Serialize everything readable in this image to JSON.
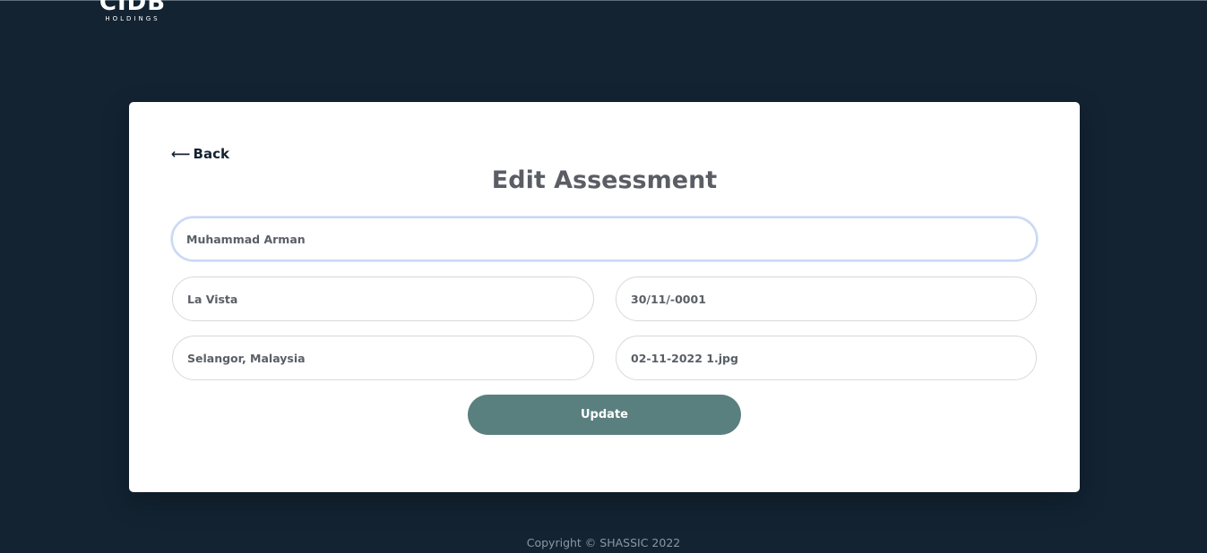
{
  "logo": {
    "main": "CIDB",
    "sub": "HOLDINGS"
  },
  "back_link": {
    "arrow": "⟵",
    "label": "Back"
  },
  "form": {
    "title": "Edit Assessment",
    "fields": {
      "name": "Muhammad Arman",
      "location": "La Vista",
      "date": "30/11/-0001",
      "state": "Selangor, Malaysia",
      "file": "02-11-2022 1.jpg"
    },
    "update_label": "Update"
  },
  "footer": {
    "copyright": "Copyright © SHASSIC 2022"
  },
  "colors": {
    "background": "#132332",
    "button": "#5a7f7f",
    "focus_border": "#c9d7f3"
  }
}
